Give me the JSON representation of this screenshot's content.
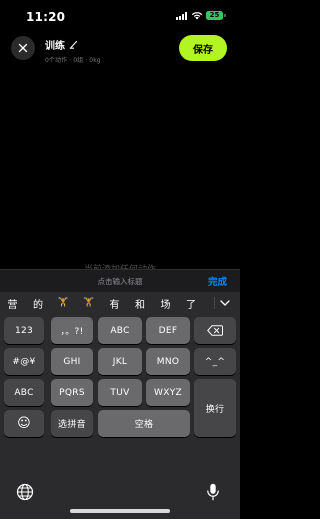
{
  "status_bar": {
    "time": "11:20",
    "battery": "25"
  },
  "header": {
    "title": "训练",
    "subtitle": "0个动作 · 0组 · 0kg",
    "save_label": "保存"
  },
  "body": {
    "hint": "当前添加任何动作"
  },
  "input_bar": {
    "placeholder": "点击输入标题",
    "done_label": "完成"
  },
  "keyboard": {
    "suggestions": [
      "营",
      "的",
      "🏋",
      "🏋",
      "有",
      "和",
      "场",
      "了"
    ],
    "row1": [
      "123",
      "，。?!",
      "ABC",
      "DEF"
    ],
    "row2": [
      "#@¥",
      "GHI",
      "JKL",
      "MNO",
      "^_^"
    ],
    "row3": [
      "ABC",
      "PQRS",
      "TUV",
      "WXYZ"
    ],
    "row4": [
      "☺",
      "选拼音",
      "空格"
    ],
    "return_label": "换行"
  },
  "colors": {
    "accent": "#b3f523",
    "done_blue": "#0a84ff",
    "battery_green": "#34c759"
  },
  "icons": [
    "close-icon",
    "pencil-icon",
    "backspace-icon",
    "chevron-down-icon",
    "globe-icon",
    "microphone-icon"
  ]
}
